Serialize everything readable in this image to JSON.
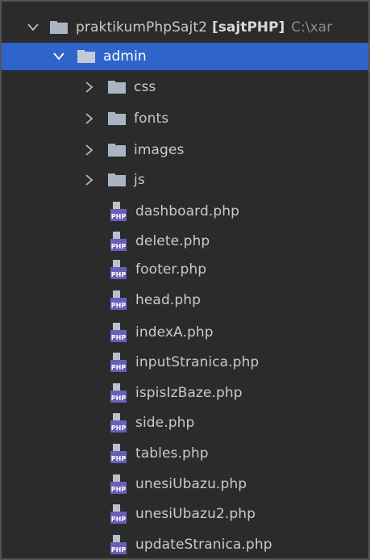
{
  "project": {
    "name": "praktikumPhpSajt2",
    "module": "[sajtPHP]",
    "path": "C:\\xar"
  },
  "folders": {
    "admin": "admin",
    "children": [
      "css",
      "fonts",
      "images",
      "js"
    ]
  },
  "files": [
    "dashboard.php",
    "delete.php",
    "footer.php",
    "head.php",
    "indexA.php",
    "inputStranica.php",
    "ispisIzBaze.php",
    "side.php",
    "tables.php",
    "unesiUbazu.php",
    "unesiUbazu2.php",
    "updateStranica.php"
  ],
  "icons": {
    "expanded": "chevron-down-icon",
    "collapsed": "chevron-right-icon",
    "folder": "folder-icon",
    "php_file": "php-file-icon"
  },
  "colors": {
    "background": "#2b2b2b",
    "selection": "#2f65ca",
    "text": "#c9c9c9"
  }
}
